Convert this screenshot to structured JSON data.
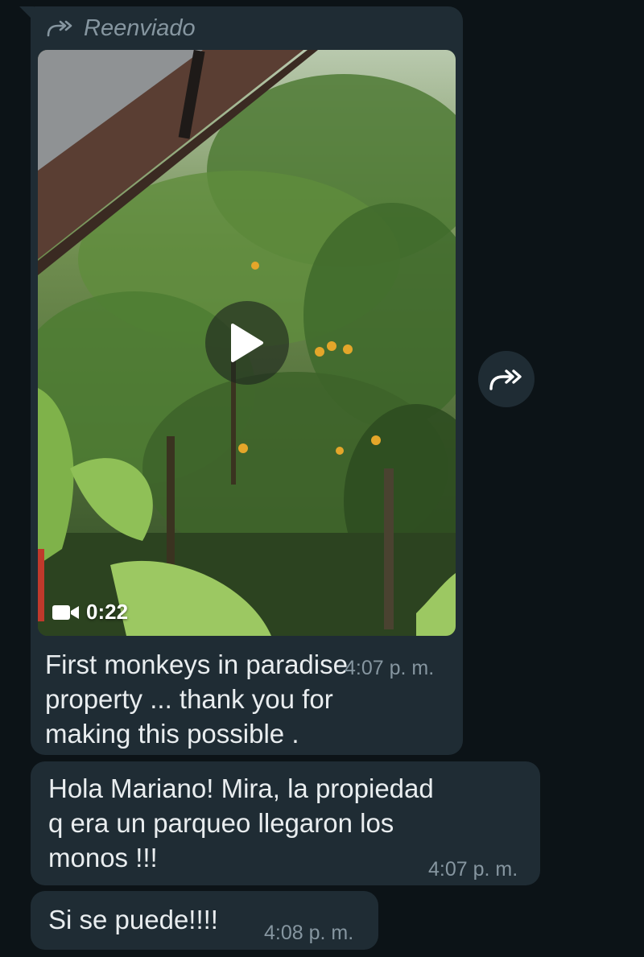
{
  "messages": [
    {
      "forwarded_label": "Reenviado",
      "video_duration": "0:22",
      "caption": "First monkeys in paradise property ... thank you for making this possible .",
      "caption_line1": "First monkeys in paradise",
      "caption_line2": "property ... thank you for",
      "caption_line3": "making this possible .",
      "time": "4:07 p. m."
    },
    {
      "text_line1": "Hola Mariano! Mira, la propiedad",
      "text_line2": "q era un parqueo llegaron los",
      "text_line3": "monos !!!",
      "time": "4:07 p. m."
    },
    {
      "text": "Si se puede!!!!",
      "time": "4:08 p. m."
    }
  ],
  "icons": {
    "forwarded": "forward-arrow-icon",
    "play": "play-icon",
    "video": "video-camera-icon",
    "forward_button": "forward-arrow-icon"
  },
  "colors": {
    "background": "#0c1317",
    "bubble": "#1f2c34",
    "text": "#e9edef",
    "meta": "#8696a0"
  }
}
